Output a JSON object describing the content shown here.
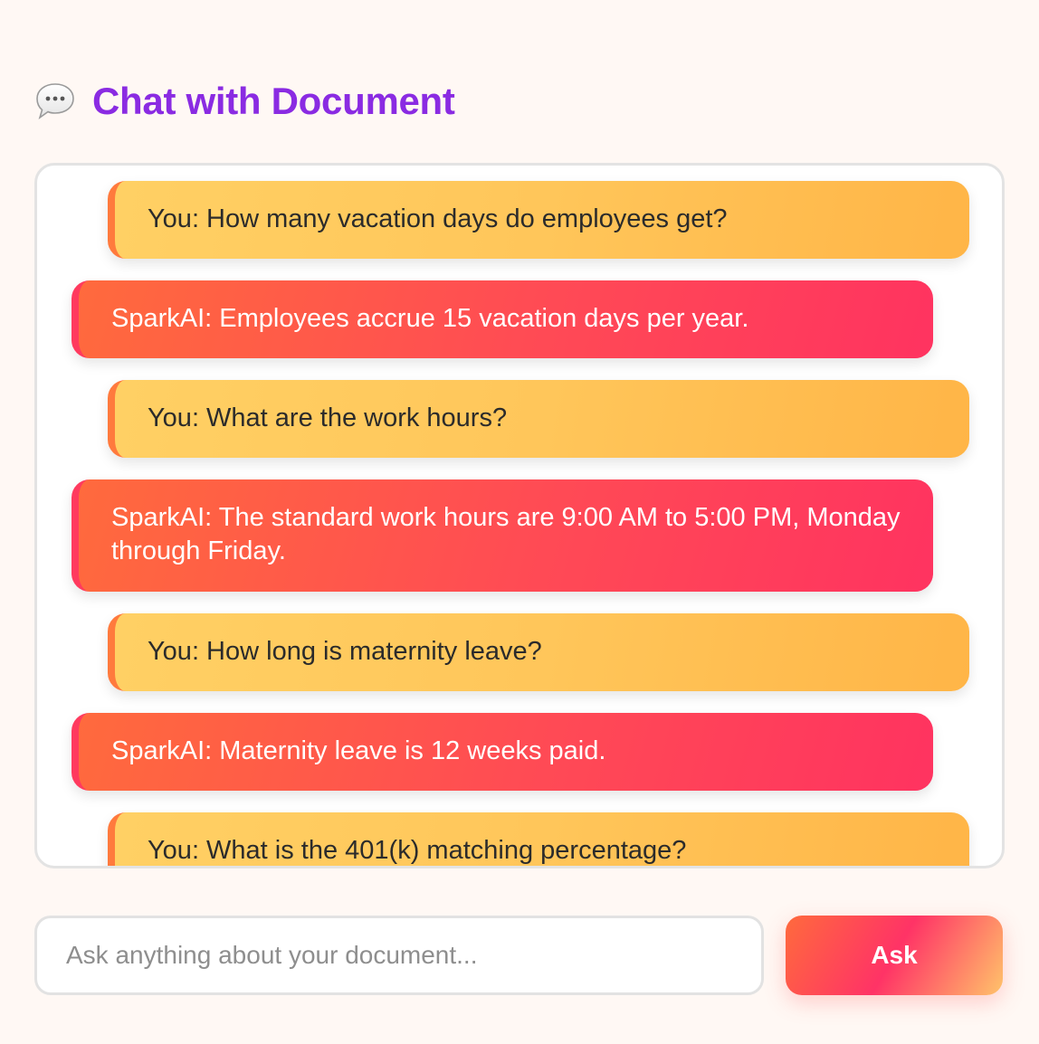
{
  "header": {
    "icon": "speech-bubble-icon",
    "title": "Chat with Document"
  },
  "colors": {
    "title": "#8a2be2",
    "user_bubble": "#ffc65a",
    "ai_bubble": "#ff4a55",
    "background": "#fff8f4"
  },
  "chat": {
    "messages": [
      {
        "role": "user",
        "text": "You: How many vacation days do employees get?"
      },
      {
        "role": "ai",
        "text": "SparkAI: Employees accrue 15 vacation days per year."
      },
      {
        "role": "user",
        "text": "You: What are the work hours?"
      },
      {
        "role": "ai",
        "text": "SparkAI: The standard work hours are 9:00 AM to 5:00 PM, Monday through Friday."
      },
      {
        "role": "user",
        "text": "You: How long is maternity leave?"
      },
      {
        "role": "ai",
        "text": "SparkAI: Maternity leave is 12 weeks paid."
      },
      {
        "role": "user",
        "text": "You: What is the 401(k) matching percentage?"
      }
    ]
  },
  "composer": {
    "placeholder": "Ask anything about your document...",
    "value": "",
    "ask_label": "Ask"
  }
}
